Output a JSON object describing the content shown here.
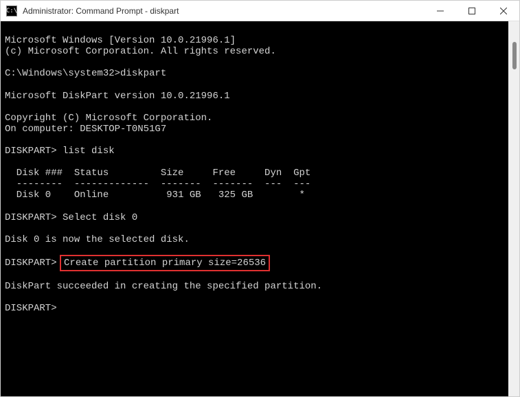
{
  "window": {
    "title": "Administrator: Command Prompt - diskpart"
  },
  "terminal": {
    "lines": {
      "l1": "Microsoft Windows [Version 10.0.21996.1]",
      "l2": "(c) Microsoft Corporation. All rights reserved.",
      "l3": "",
      "l4": "C:\\Windows\\system32>diskpart",
      "l5": "",
      "l6": "Microsoft DiskPart version 10.0.21996.1",
      "l7": "",
      "l8": "Copyright (C) Microsoft Corporation.",
      "l9": "On computer: DESKTOP-T0N51G7",
      "l10": "",
      "l11": "DISKPART> list disk",
      "l12": "",
      "l13": "  Disk ###  Status         Size     Free     Dyn  Gpt",
      "l14": "  --------  -------------  -------  -------  ---  ---",
      "l15": "  Disk 0    Online          931 GB   325 GB        *",
      "l16": "",
      "l17": "DISKPART> Select disk 0",
      "l18": "",
      "l19": "Disk 0 is now the selected disk.",
      "l20": "",
      "l21_prompt": "DISKPART> ",
      "l21_cmd": "Create partition primary size=26536",
      "l22": "",
      "l23": "DiskPart succeeded in creating the specified partition.",
      "l24": "",
      "l25": "DISKPART>"
    }
  }
}
